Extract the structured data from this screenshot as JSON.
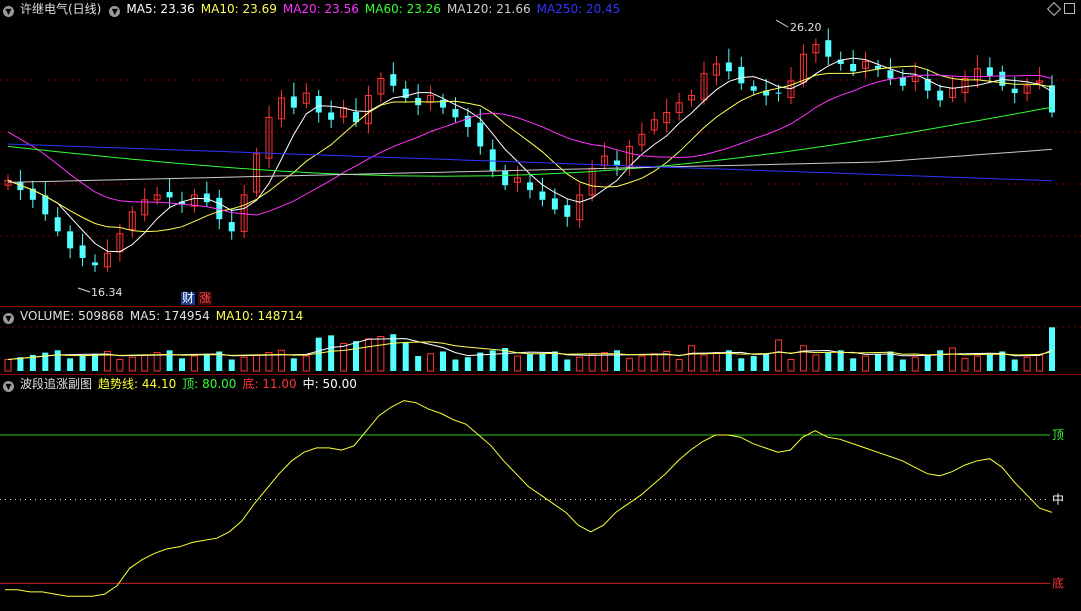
{
  "main": {
    "title": "许继电气(日线)",
    "ma_items": [
      {
        "label": "MA5: 23.36",
        "color": "#ffffff"
      },
      {
        "label": "MA10: 23.69",
        "color": "#ffff55"
      },
      {
        "label": "MA20: 23.56",
        "color": "#ff33ff"
      },
      {
        "label": "MA60: 23.26",
        "color": "#33ff33"
      },
      {
        "label": "MA120: 21.66",
        "color": "#cccccc"
      },
      {
        "label": "MA250: 20.45",
        "color": "#3333ff"
      }
    ],
    "high_label": "26.20",
    "low_label": "16.34",
    "badge_cai": "财",
    "badge_zhang": "涨",
    "candle_colors": {
      "up": "#ff3333",
      "down": "#54ffff"
    }
  },
  "volume": {
    "title": "VOLUME: 509868",
    "ma5": "MA5: 174954",
    "ma10": "MA10: 148714"
  },
  "indicator": {
    "title": "波段追涨副图",
    "trend": "趋势线: 44.10",
    "top": "顶: 80.00",
    "bottom": "底: 11.00",
    "mid": "中: 50.00",
    "top_tag": "顶",
    "mid_tag": "中",
    "bottom_tag": "底",
    "values": [
      8,
      8,
      7,
      7,
      6,
      5,
      5,
      5,
      6,
      10,
      18,
      22,
      25,
      27,
      28,
      30,
      31,
      32,
      35,
      40,
      48,
      55,
      62,
      68,
      72,
      74,
      74,
      73,
      75,
      82,
      89,
      93,
      96,
      95,
      92,
      90,
      87,
      85,
      80,
      75,
      68,
      62,
      56,
      52,
      48,
      44,
      38,
      35,
      38,
      44,
      48,
      52,
      57,
      62,
      68,
      73,
      77,
      80,
      80,
      79,
      76,
      74,
      72,
      73,
      79,
      82,
      79,
      78,
      76,
      74,
      72,
      70,
      68,
      65,
      62,
      61,
      63,
      66,
      68,
      69,
      65,
      58,
      52,
      46,
      44
    ]
  }
}
